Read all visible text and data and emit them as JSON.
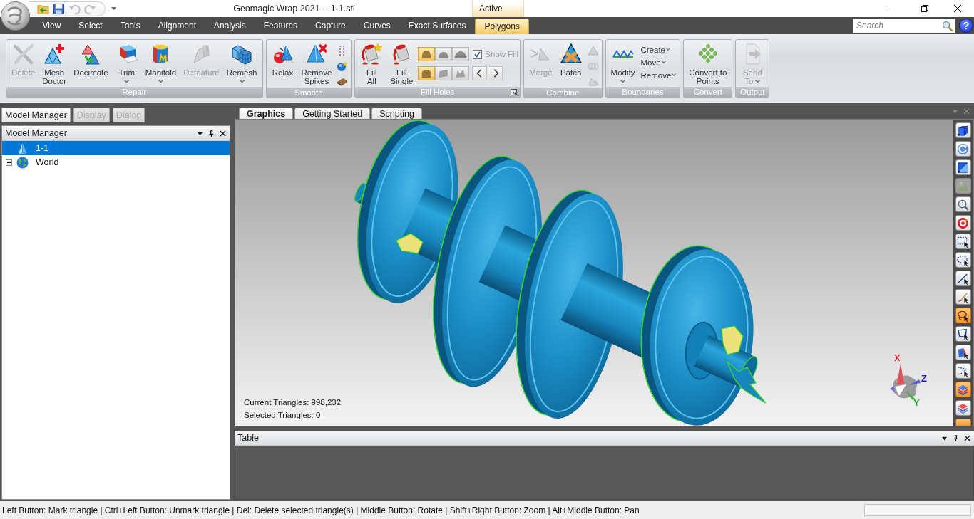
{
  "window": {
    "title": "Geomagic Wrap 2021 -- 1-1.stl",
    "context_tab_header": "Active"
  },
  "quick_access_toolbar": [
    {
      "disabled": false
    },
    {
      "disabled": false
    },
    {
      "disabled": true
    },
    {
      "disabled": true
    }
  ],
  "ribbon_tabs": [
    {
      "label": "View",
      "selected": false
    },
    {
      "label": "Select",
      "selected": false
    },
    {
      "label": "Tools",
      "selected": false
    },
    {
      "label": "Alignment",
      "selected": false
    },
    {
      "label": "Analysis",
      "selected": false
    },
    {
      "label": "Features",
      "selected": false
    },
    {
      "label": "Capture",
      "selected": false
    },
    {
      "label": "Curves",
      "selected": false
    },
    {
      "label": "Exact Surfaces",
      "selected": false
    },
    {
      "label": "Polygons",
      "selected": true
    }
  ],
  "search": {
    "placeholder": "Search"
  },
  "help_button": "?",
  "ribbon_groups": [
    {
      "label": "Repair",
      "buttons": [
        {
          "label": "Delete",
          "disabled": true,
          "dropdown": false
        },
        {
          "label": "Mesh\nDoctor",
          "disabled": false,
          "dropdown": false
        },
        {
          "label": "Decimate",
          "disabled": false,
          "dropdown": false
        },
        {
          "label": "Trim",
          "disabled": false,
          "dropdown": true
        },
        {
          "label": "Manifold",
          "disabled": false,
          "dropdown": true
        },
        {
          "label": "Defeature",
          "disabled": true,
          "dropdown": false
        },
        {
          "label": "Remesh",
          "disabled": false,
          "dropdown": true
        }
      ]
    },
    {
      "label": "Smooth",
      "buttons": [
        {
          "label": "Relax",
          "disabled": false,
          "dropdown": false
        },
        {
          "label": "Remove\nSpikes",
          "disabled": false,
          "dropdown": false
        }
      ],
      "small_buttons": [
        {
          "disabled": false
        },
        {
          "disabled": false
        },
        {
          "disabled": false
        }
      ]
    },
    {
      "label": "Fill Holes",
      "buttons": [
        {
          "label": "Fill\nAll",
          "disabled": false,
          "dropdown": false
        },
        {
          "label": "Fill\nSingle",
          "disabled": false,
          "dropdown": false
        }
      ],
      "fill_type_toggles": [
        {
          "selected": true
        },
        {
          "selected": false
        },
        {
          "selected": false
        }
      ],
      "fill_mode_toggles": [
        {
          "selected": true
        },
        {
          "selected": false
        },
        {
          "selected": false
        }
      ],
      "show_fill": {
        "label": "Show Fill",
        "checked": true,
        "disabled": true
      }
    },
    {
      "label": "Combine",
      "buttons": [
        {
          "label": "Merge",
          "disabled": true,
          "dropdown": false
        },
        {
          "label": "Patch",
          "disabled": false,
          "dropdown": false
        }
      ],
      "small_buttons": [
        {
          "disabled": true
        },
        {
          "disabled": true
        },
        {
          "disabled": true
        }
      ]
    },
    {
      "label": "Boundaries",
      "buttons": [
        {
          "label": "Modify",
          "disabled": false,
          "dropdown": true
        }
      ],
      "menu_buttons": [
        {
          "label": "Create"
        },
        {
          "label": "Move"
        },
        {
          "label": "Remove"
        }
      ]
    },
    {
      "label": "Convert",
      "buttons": [
        {
          "label": "Convert to\nPoints",
          "disabled": false,
          "dropdown": false
        }
      ]
    },
    {
      "label": "Output",
      "buttons": [
        {
          "label": "Send\nTo",
          "disabled": true,
          "dropdown": true
        }
      ]
    }
  ],
  "left_panel": {
    "tabs": [
      {
        "label": "Model Manager",
        "selected": true
      },
      {
        "label": "Display",
        "selected": false
      },
      {
        "label": "Dialog",
        "selected": false
      }
    ],
    "title": "Model Manager",
    "tree": [
      {
        "kind": "mesh",
        "label": "1-1",
        "selected": true
      },
      {
        "kind": "group",
        "label": "World",
        "selected": false,
        "expanded": false
      }
    ]
  },
  "viewport": {
    "tabs": [
      {
        "label": "Graphics",
        "selected": true
      },
      {
        "label": "Getting Started",
        "selected": false
      },
      {
        "label": "Scripting",
        "selected": false
      }
    ],
    "stats": [
      "Current Triangles: 998,232",
      "Selected Triangles: 0"
    ],
    "axis_labels": [
      "X",
      "Z",
      "Y"
    ],
    "view_tools": [
      {
        "on": false,
        "disabled": false
      },
      {
        "on": false,
        "disabled": false
      },
      {
        "on": false,
        "disabled": false
      },
      {
        "on": false,
        "disabled": true
      },
      {
        "on": false,
        "disabled": false
      },
      {
        "on": false,
        "disabled": false
      },
      {
        "on": false,
        "disabled": false
      },
      {
        "on": false,
        "disabled": false
      },
      {
        "on": false,
        "disabled": false
      },
      {
        "on": false,
        "disabled": false
      },
      {
        "on": true,
        "disabled": false
      },
      {
        "on": false,
        "disabled": false
      },
      {
        "on": false,
        "disabled": false
      },
      {
        "on": false,
        "disabled": false
      },
      {
        "on": true,
        "disabled": false
      },
      {
        "on": false,
        "disabled": false
      },
      {
        "on": true,
        "disabled": false
      }
    ]
  },
  "table_panel": {
    "title": "Table"
  },
  "status_bar": {
    "text": "Left Button: Mark triangle | Ctrl+Left Button: Unmark triangle | Del: Delete selected triangle(s) | Middle Button: Rotate | Shift+Right Button: Zoom | Alt+Middle Button: Pan"
  }
}
